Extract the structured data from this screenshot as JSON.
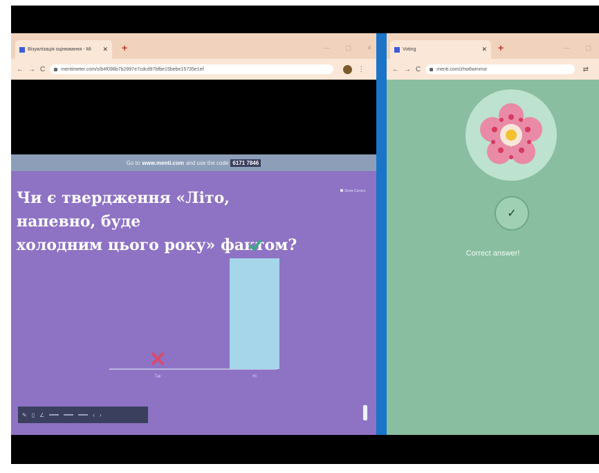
{
  "left_window": {
    "tab_title": "Візуалізація оцінювання - Mi",
    "tab_close": "✕",
    "new_tab": "+",
    "url": "mentimeter.com/s/b4f098b7b2997e7cdcd97bfbe15bebe15735e1ef",
    "window_controls": "— ▢ ✕"
  },
  "right_window": {
    "tab_title": "Voting",
    "tab_close": "✕",
    "new_tab": "+",
    "url": "menti.com/zhw6wmmsr",
    "window_controls": "— ▢"
  },
  "slide": {
    "banner_prefix": "Go to",
    "banner_site": "www.menti.com",
    "banner_middle": "and use the code",
    "banner_code": "6171 7846",
    "question_line1": "Чи є твердження «Літо, напевно, буде",
    "question_line2": "холодним цього року» фактом?",
    "corner_label": "Show Correct",
    "chart_data": {
      "type": "bar",
      "categories": [
        "Так",
        "Ні"
      ],
      "values": [
        0,
        1
      ],
      "ylim": [
        0,
        1
      ],
      "correct": [
        false,
        true
      ],
      "colors": {
        "bar": "#a6d6ea",
        "wrong": "#d94a6e",
        "correct": "#3fa68a",
        "axis": "#c8d0e8"
      }
    }
  },
  "participant": {
    "correct_text": "Correct answer!",
    "check_mark": "✓"
  },
  "colors": {
    "slide_bg": "#8e73c4",
    "participant_bg": "#89bea0",
    "divider": "#1a75c9"
  },
  "icons": {
    "toolbar": [
      "pen-icon",
      "eraser-icon",
      "marker-icon",
      "line-icon",
      "shape-icon",
      "text-icon",
      "prev-icon",
      "next-icon"
    ]
  }
}
